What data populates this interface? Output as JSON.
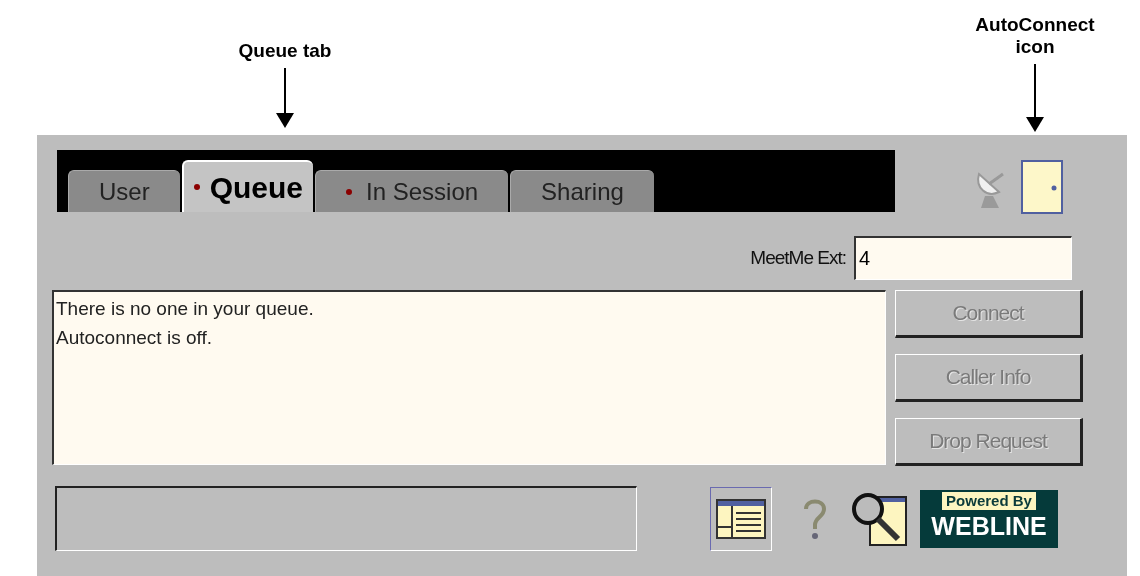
{
  "callouts": [
    {
      "kind": "tab",
      "label": "Queue tab"
    },
    {
      "kind": "autoconnect",
      "label": "AutoConnect icon"
    }
  ],
  "tabs": [
    {
      "label": "User",
      "selected": false,
      "dot": false
    },
    {
      "label": "Queue",
      "selected": true,
      "dot": true
    },
    {
      "label": "In Session",
      "selected": false,
      "dot": true
    },
    {
      "label": "Sharing",
      "selected": false,
      "dot": false
    }
  ],
  "meetme": {
    "label": "MeetMe Ext:",
    "value": "4"
  },
  "messages": [
    "There is no one in your queue.",
    "Autoconnect is off."
  ],
  "buttons": [
    {
      "label": "Connect",
      "disabled": true
    },
    {
      "label": "Caller Info",
      "disabled": true
    },
    {
      "label": "Drop Request",
      "disabled": true
    }
  ],
  "logo": {
    "top": "Powered By",
    "bottom": "WEBLINE"
  }
}
